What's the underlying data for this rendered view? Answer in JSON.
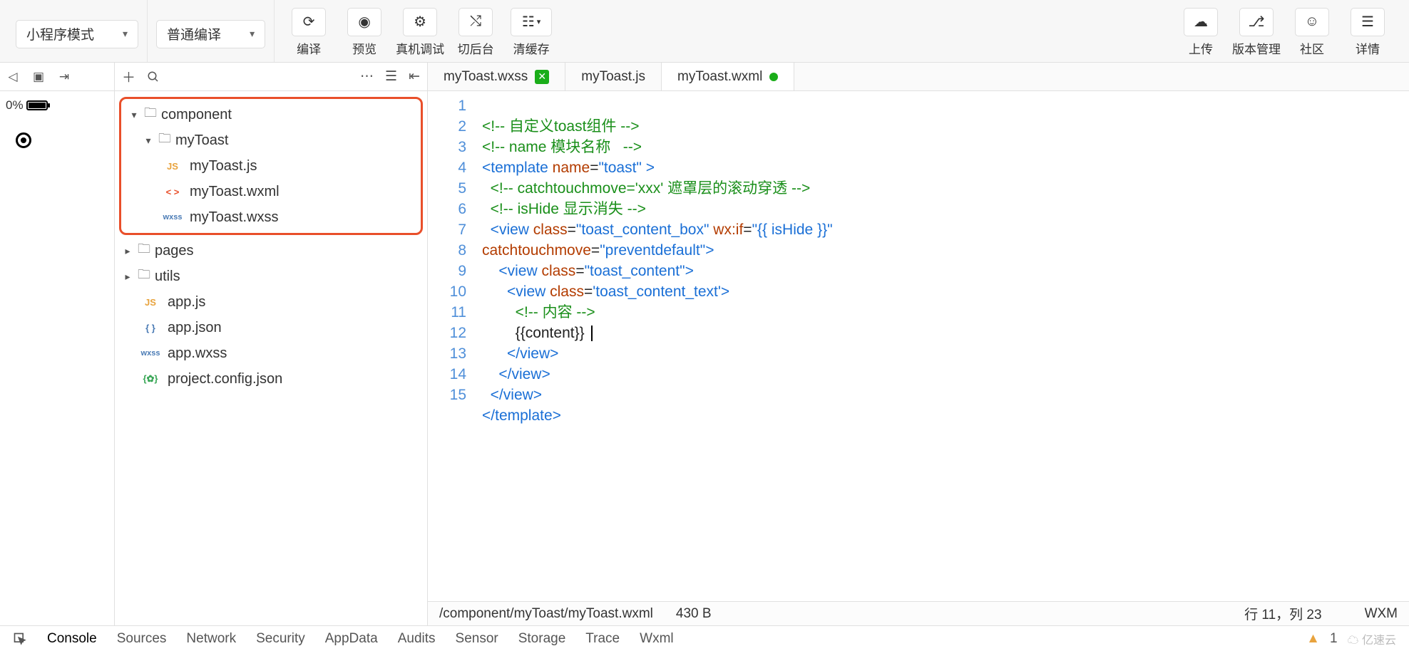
{
  "topbar": {
    "mode_dropdown": "小程序模式",
    "compile_dropdown": "普通编译",
    "buttons": {
      "compile": "编译",
      "preview": "预览",
      "remote_debug": "真机调试",
      "background": "切后台",
      "clear_cache": "清缓存",
      "upload": "上传",
      "version": "版本管理",
      "community": "社区",
      "details": "详情"
    }
  },
  "sim": {
    "battery_pct": "0%"
  },
  "tree": {
    "component": "component",
    "myToast_folder": "myToast",
    "myToast_js": "myToast.js",
    "myToast_wxml": "myToast.wxml",
    "myToast_wxss": "myToast.wxss",
    "pages": "pages",
    "utils": "utils",
    "app_js": "app.js",
    "app_json": "app.json",
    "app_wxss": "app.wxss",
    "project_config": "project.config.json"
  },
  "tabs": {
    "t1": "myToast.wxss",
    "t2": "myToast.js",
    "t3": "myToast.wxml"
  },
  "code": {
    "l1": "<!-- 自定义toast组件 -->",
    "l2": "<!-- name 模块名称   -->",
    "l3a": "<",
    "l3b": "template",
    "l3c": " name",
    "l3d": "=",
    "l3e": "\"toast\"",
    "l3f": " >",
    "l4": "  <!-- catchtouchmove='xxx' 遮罩层的滚动穿透 -->",
    "l5": "  <!-- isHide 显示消失 -->",
    "l6a": "  <",
    "l6b": "view",
    "l6c": " class",
    "l6d": "=",
    "l6e": "\"toast_content_box\"",
    "l6f": " wx:if",
    "l6g": "=",
    "l6h": "\"{{ isHide }}\"",
    "l7a": "catchtouchmove",
    "l7b": "=",
    "l7c": "\"preventdefault\"",
    "l7d": ">",
    "l8a": "    <",
    "l8b": "view",
    "l8c": " class",
    "l8d": "=",
    "l8e": "\"toast_content\"",
    "l8f": ">",
    "l9a": "      <",
    "l9b": "view",
    "l9c": " class",
    "l9d": "=",
    "l9e": "'toast_content_text'",
    "l9f": ">",
    "l10": "        <!-- 内容 -->",
    "l11": "        {{content}} ",
    "l12a": "      </",
    "l12b": "view",
    "l12c": ">",
    "l13a": "    </",
    "l13b": "view",
    "l13c": ">",
    "l14a": "  </",
    "l14b": "view",
    "l14c": ">",
    "l15a": "</",
    "l15b": "template",
    "l15c": ">"
  },
  "status": {
    "path": "/component/myToast/myToast.wxml",
    "size": "430 B",
    "cursor": "行 11，列 23",
    "lang": "WXM"
  },
  "bottom_tabs": {
    "console": "Console",
    "sources": "Sources",
    "network": "Network",
    "security": "Security",
    "appdata": "AppData",
    "audits": "Audits",
    "sensor": "Sensor",
    "storage": "Storage",
    "trace": "Trace",
    "wxml": "Wxml",
    "warn_count": "1",
    "watermark": "亿速云"
  },
  "file_icons": {
    "js": "JS",
    "wxml": "< >",
    "wxss": "wxss",
    "json": "{ }",
    "cfg": "{✿}"
  }
}
